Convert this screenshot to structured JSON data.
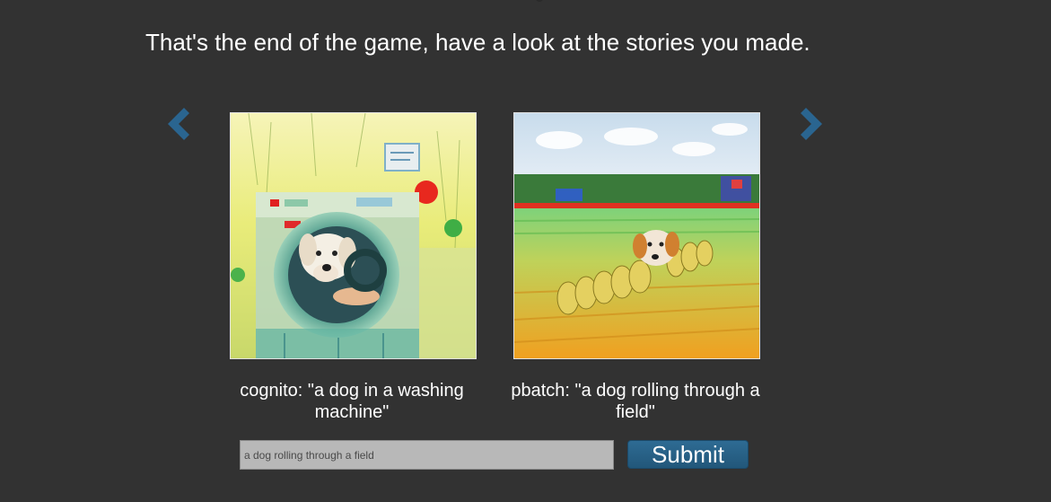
{
  "heading": "That's the end of the game, have a look at the stories you made.",
  "nav": {
    "prev_icon": "chevron-left-icon",
    "next_icon": "chevron-right-icon",
    "arrow_color": "#2a6590"
  },
  "stories": [
    {
      "author": "cognito",
      "caption": "cognito: \"a dog in a washing machine\"",
      "image_subject": "dog-in-washing-machine"
    },
    {
      "author": "pbatch",
      "caption": "pbatch: \"a dog rolling through a field\"",
      "image_subject": "dog-rolling-through-field"
    }
  ],
  "form": {
    "input_value": "a dog rolling through a field",
    "submit_label": "Submit",
    "button_color": "#2a6590"
  },
  "colors": {
    "background": "#323232",
    "text": "#ffffff"
  }
}
